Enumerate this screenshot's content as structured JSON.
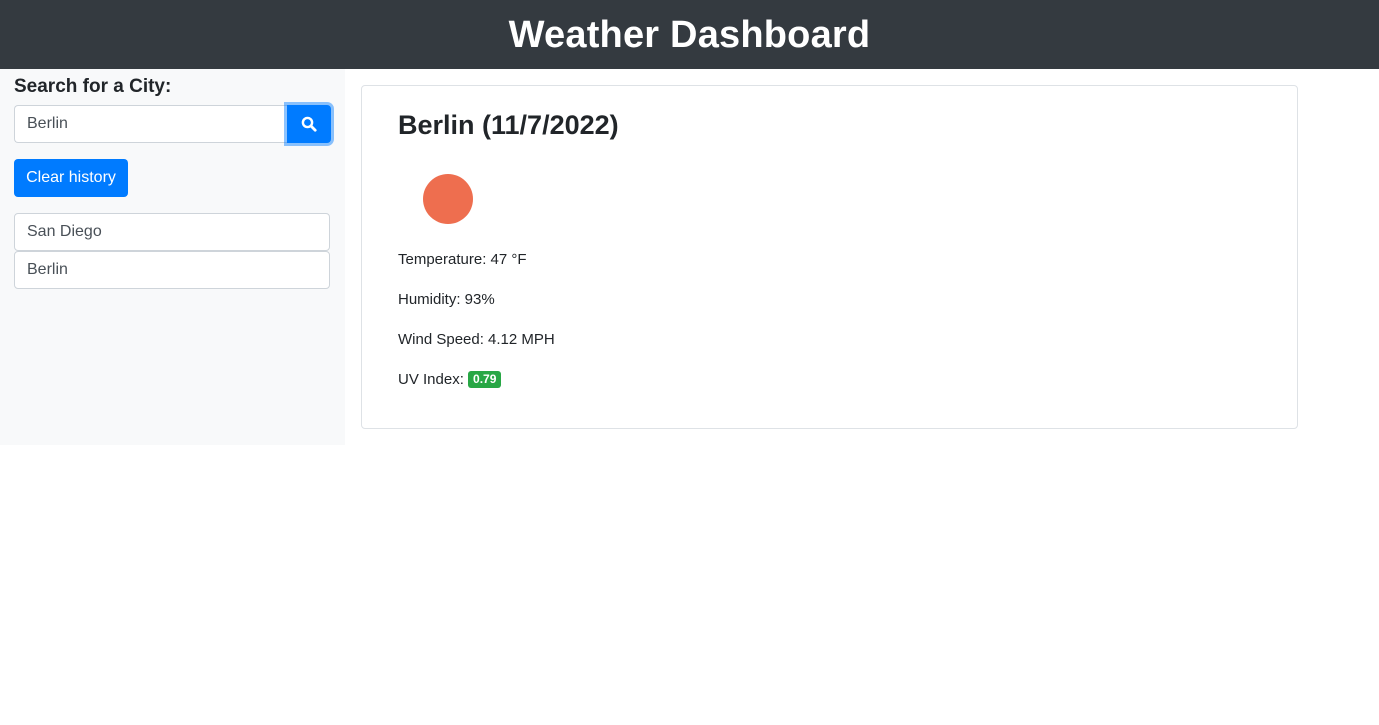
{
  "header": {
    "title": "Weather Dashboard"
  },
  "sidebar": {
    "search_label": "Search for a City:",
    "search_value": "Berlin",
    "search_icon": "search-icon",
    "clear_label": "Clear history",
    "history": [
      "San Diego",
      "Berlin"
    ]
  },
  "current": {
    "title": "Berlin (11/7/2022)",
    "icon": "sun-icon",
    "temperature": "Temperature: 47 °F",
    "humidity": "Humidity: 93%",
    "wind": "Wind Speed: 4.12 MPH",
    "uv_label": "UV Index:",
    "uv_value": "0.79",
    "uv_color": "#28a745"
  },
  "colors": {
    "header_bg": "#343a40",
    "accent": "#007bff",
    "sun": "#ee6e4f"
  }
}
